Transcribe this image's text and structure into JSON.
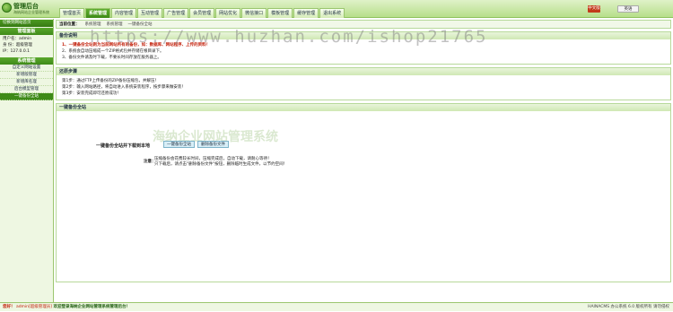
{
  "app": {
    "title": "管理后台",
    "subtitle": "海纳网站企业管理系统"
  },
  "nav": {
    "tabs": [
      "管理首页",
      "系统管理",
      "内容管理",
      "互动管理",
      "广告管理",
      "会员管理",
      "网站优化",
      "微信接口",
      "模板管理",
      "缓存管理",
      "退出系统"
    ],
    "active_index": 1
  },
  "top_buttons": {
    "cn": "中文版",
    "en": "英语"
  },
  "sidebar": {
    "head": "切换到网站首页",
    "title": "管理面板",
    "info": [
      "用户名：admin",
      "身 份：超级管理",
      "IP：127.0.0.1"
    ],
    "section_title": "系统管理",
    "items": [
      "自定义网站设置",
      "新增版管理",
      "新增库名理",
      "后台模型管理",
      "一键备份全站"
    ],
    "active_item": 4
  },
  "breadcrumb": [
    "当前位置：",
    "系统管理",
    "系统管理",
    "一键备份全站"
  ],
  "sections": {
    "info_title": "备份说明",
    "info_lines": [
      "1、一键备份全站则为当前网站所有的备份，如：数据库、网站程序、上传的资料！",
      "2、系统会自动压缩成一个ZIP格式包并存储在根目录下。",
      "3、备份文件请及时下载，不要长时间存放在服务器上。"
    ],
    "steps_title": "还原步骤",
    "steps": [
      "第1步：通过FTP上传备份的ZIP备份压缩包，并解压！",
      "第2步：输入网站路径，将自动进入系统安装程序，按步骤来做安装！",
      "第3步：安装完成即可还原成功！"
    ],
    "op_title": "一键备份全站",
    "op_label": "一键备份全站并下载到本地",
    "btn_backup": "一键备份全站",
    "btn_delete": "删除备份文件",
    "note_label": "注意：",
    "note_lines": [
      "压缩备份会花费较长时间，压缩完成后，自动下载，请耐心等待！",
      "只下载后，请点击\"删除备份文件\"按钮，删除临时生成文件，以节约空间！"
    ]
  },
  "status": {
    "left_parts": [
      "您好！",
      "admin[超级管理员]",
      "欢迎登录海纳企业网站管理系统管理后台！"
    ],
    "right": "HAINACMS 办公系统 6.0 版权所有 请勿侵权"
  },
  "watermark": {
    "url": "https://www.huzhan.com/ishop21765",
    "brand": "海纳企业网站管理系统"
  },
  "colors": {
    "accent": "#3e8a18",
    "header": "#b7df8a",
    "red": "#c3200b"
  }
}
